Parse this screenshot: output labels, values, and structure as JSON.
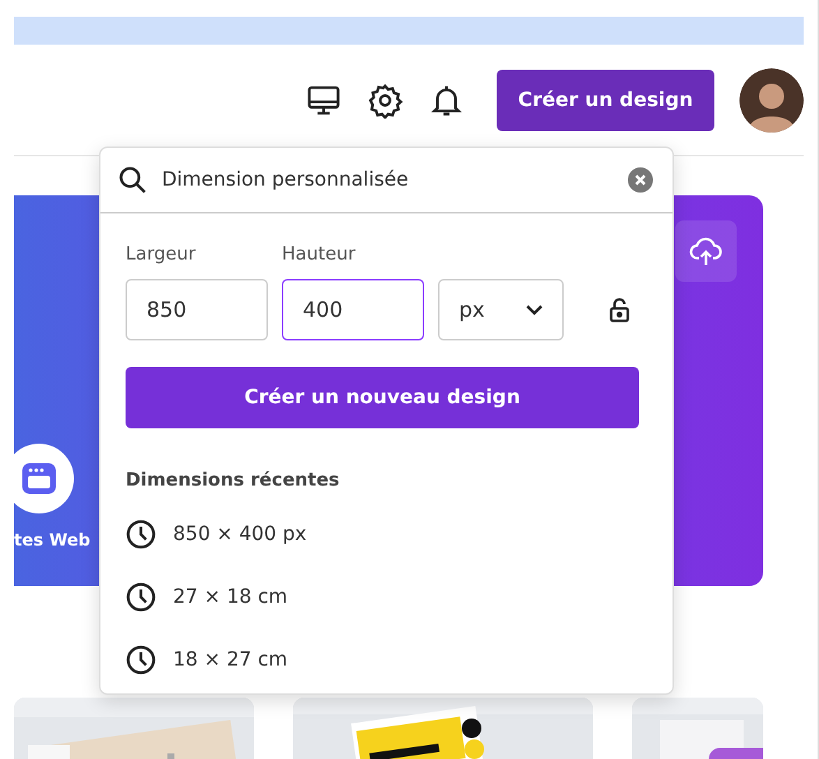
{
  "header": {
    "create_button": "Créer un design"
  },
  "banner": {
    "tile_label": "tes Web"
  },
  "dropdown": {
    "search": {
      "value": "Dimension personnalisée"
    },
    "fields": [
      {
        "label": "Largeur",
        "value": "850",
        "focused": false
      },
      {
        "label": "Hauteur",
        "value": "400",
        "focused": true
      }
    ],
    "unit": "px",
    "create_button": "Créer un nouveau design",
    "recent": {
      "title": "Dimensions récentes",
      "items": [
        "850 × 400 px",
        "27 × 18 cm",
        "18 × 27 cm"
      ]
    }
  }
}
